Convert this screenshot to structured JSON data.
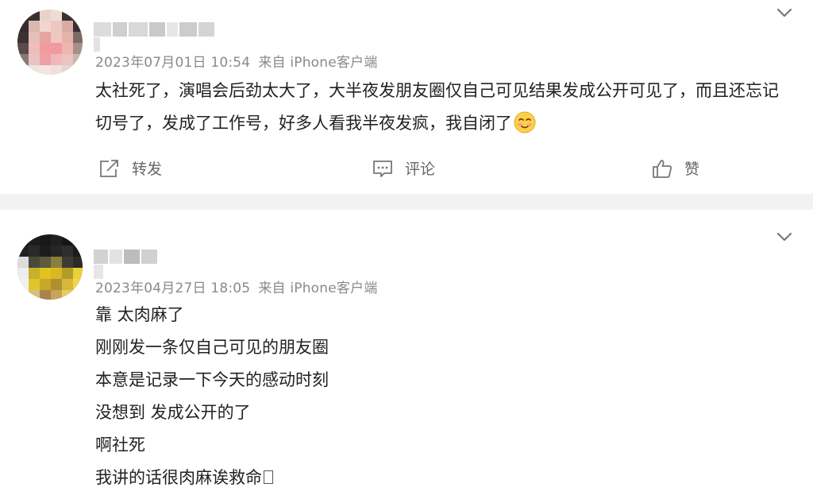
{
  "posts": [
    {
      "date": "2023年07月01日 10:54",
      "source": "来自 iPhone客户端",
      "content": "太社死了，演唱会后劲太大了，大半夜发朋友圈仅自己可见结果发成公开可见了，而且还忘记切号了，发成了工作号，好多人看我半夜发疯，我自闭了",
      "emoji": "blushing-face-emoji"
    },
    {
      "date": "2023年04月27日 18:05",
      "source": "来自 iPhone客户端",
      "lines": [
        "靠 太肉麻了",
        "刚刚发一条仅自己可见的朋友圈",
        "本意是记录一下今天的感动时刻",
        "没想到 发成公开的了",
        "啊社死",
        "我讲的话很肉麻诶救命"
      ]
    }
  ],
  "actions": {
    "forward_label": "转发",
    "comment_label": "评论",
    "like_label": "赞"
  },
  "icons": [
    "chevron-down-icon",
    "share-icon",
    "comment-icon",
    "thumbs-up-icon",
    "blushing-face-emoji"
  ],
  "colors": {
    "divider": "#f2f2f2",
    "meta_text": "#8a8a8a",
    "body_text": "#222222",
    "action_text": "#666666"
  }
}
